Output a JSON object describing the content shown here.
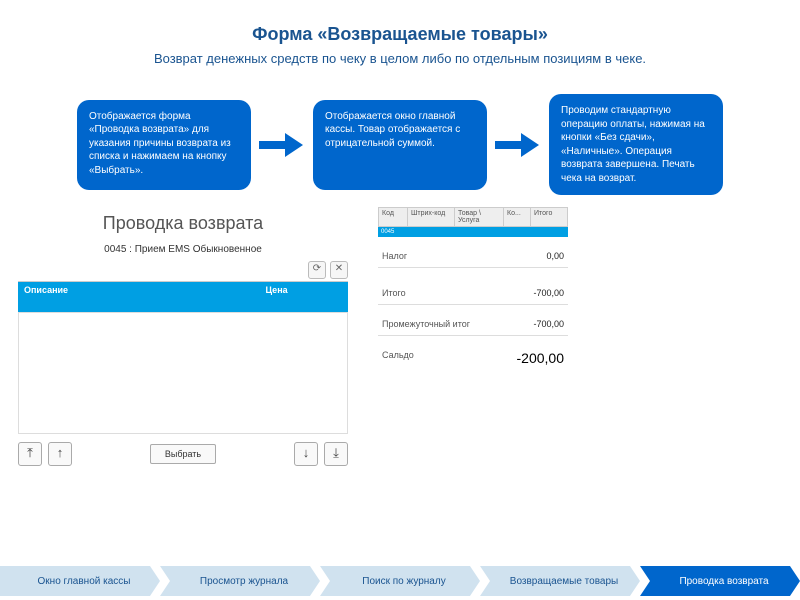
{
  "title": "Форма «Возвращаемые товары»",
  "subtitle": "Возврат денежных средств по чеку в целом либо по отдельным позициям в чеке.",
  "notes": [
    "Отображается форма «Проводка возврата» для указания причины возврата из списка и нажимаем на кнопку «Выбрать».",
    "Отображается окно главной кассы. Товар отображается с отрицательной суммой.",
    "Проводим стандартную операцию оплаты, нажимая на кнопки «Без сдачи», «Наличные». Операция возврата завершена. Печать чека на возврат."
  ],
  "shot1": {
    "windowTitle": "Проводка возврата",
    "subLabel": "0045 : Прием EMS Обыкновенное",
    "columns": [
      "Описание",
      "Цена"
    ],
    "selectBtn": "Выбрать"
  },
  "shot2": {
    "headers": [
      "Код",
      "Штрих-код",
      "Товар \\ Услуга",
      "Ко...",
      "Итого"
    ],
    "rows": [
      {
        "label": "Налог",
        "value": "0,00"
      },
      {
        "label": "Итого",
        "value": "-700,00"
      },
      {
        "label": "Промежуточный итог",
        "value": "-700,00"
      },
      {
        "label": "Сальдо",
        "value": "-200,00"
      }
    ]
  },
  "crumbs": [
    "Окно главной кассы",
    "Просмотр журнала",
    "Поиск по журналу",
    "Возвращаемые товары",
    "Проводка возврата"
  ],
  "activeCrumb": 4
}
